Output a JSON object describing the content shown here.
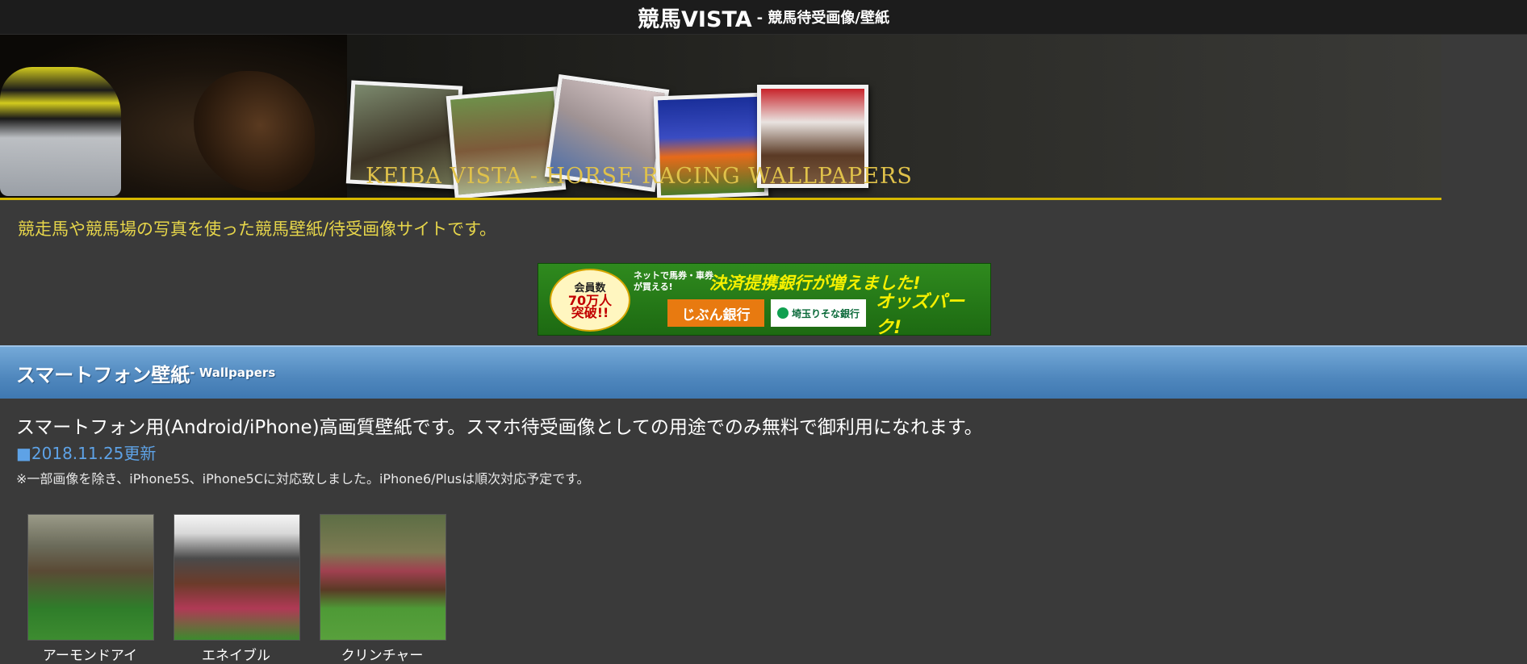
{
  "topbar": {
    "brand": "競馬VISTA",
    "subtitle": "- 競馬待受画像/壁紙"
  },
  "header": {
    "caption": "KEIBA VISTA  - HORSE RACING WALLPAPERS"
  },
  "intro": "競走馬や競馬場の写真を使った競馬壁紙/待受画像サイトです。",
  "ad": {
    "badge_line1": "会員数",
    "badge_line2": "70万人",
    "badge_line3": "突破!!",
    "small_text": "ネットで馬券・車券が買える!",
    "headline": "決済提携銀行が増えました!",
    "bank1": "じぶん銀行",
    "bank2": "埼玉りそな銀行",
    "brand": "オッズパーク!"
  },
  "section": {
    "title": "スマートフォン壁紙",
    "subtitle": "- Wallpapers"
  },
  "content": {
    "description": "スマートフォン用(Android/iPhone)高画質壁紙です。スマホ待受画像としての用途でのみ無料で御利用になれます。",
    "update": "■2018.11.25更新",
    "note": "※一部画像を除き、iPhone5S、iPhone5Cに対応致しました。iPhone6/Plusは順次対応予定です。"
  },
  "thumbnails": [
    {
      "caption": "アーモンドアイ"
    },
    {
      "caption": "エネイブル"
    },
    {
      "caption": "クリンチャー"
    }
  ],
  "colors": {
    "topbar_bg": "#1c1c1c",
    "page_bg": "#3a3a3a",
    "intro_text": "#e6d54a",
    "section_bar": "#4f87bd",
    "update_link": "#5ea2e6",
    "banner_underline": "#d6b800"
  }
}
